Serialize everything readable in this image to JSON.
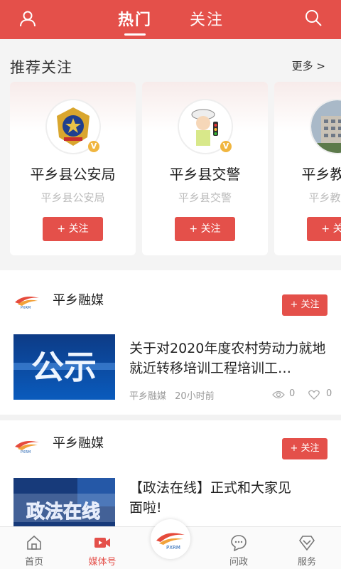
{
  "header": {
    "tabs": [
      {
        "label": "热门"
      },
      {
        "label": "关注"
      }
    ],
    "user_icon": "user-icon",
    "search_icon": "search-icon"
  },
  "recommend": {
    "title": "推荐关注",
    "more": "更多 >",
    "cards": [
      {
        "name": "平乡县公安局",
        "sub": "平乡县公安局",
        "follow": "+ 关注"
      },
      {
        "name": "平乡县交警",
        "sub": "平乡县交警",
        "follow": "+ 关注"
      },
      {
        "name": "平乡教育",
        "sub": "平乡教育",
        "follow": "+ 关注"
      }
    ]
  },
  "feed": [
    {
      "source": "平乡融媒",
      "follow": "+ 关注",
      "title": "关于对2020年度农村劳动力就地就近转移培训工程培训工…",
      "thumb_text": "公示",
      "meta_source": "平乡融媒",
      "meta_time": "20小时前",
      "views": "0",
      "likes": "0"
    },
    {
      "source": "平乡融媒",
      "follow": "+ 关注",
      "title": "【政法在线】正式和大家见面啦!",
      "thumb_text": "政法在线"
    }
  ],
  "logo_text": "PXRM",
  "bottom_nav": [
    {
      "label": "首页",
      "icon": "home-icon"
    },
    {
      "label": "媒体号",
      "icon": "video-icon"
    },
    {
      "label": "",
      "icon": "center-logo"
    },
    {
      "label": "问政",
      "icon": "chat-icon"
    },
    {
      "label": "服务",
      "icon": "diamond-icon"
    }
  ],
  "colors": {
    "accent": "#e4504a",
    "badge": "#f0b640"
  }
}
